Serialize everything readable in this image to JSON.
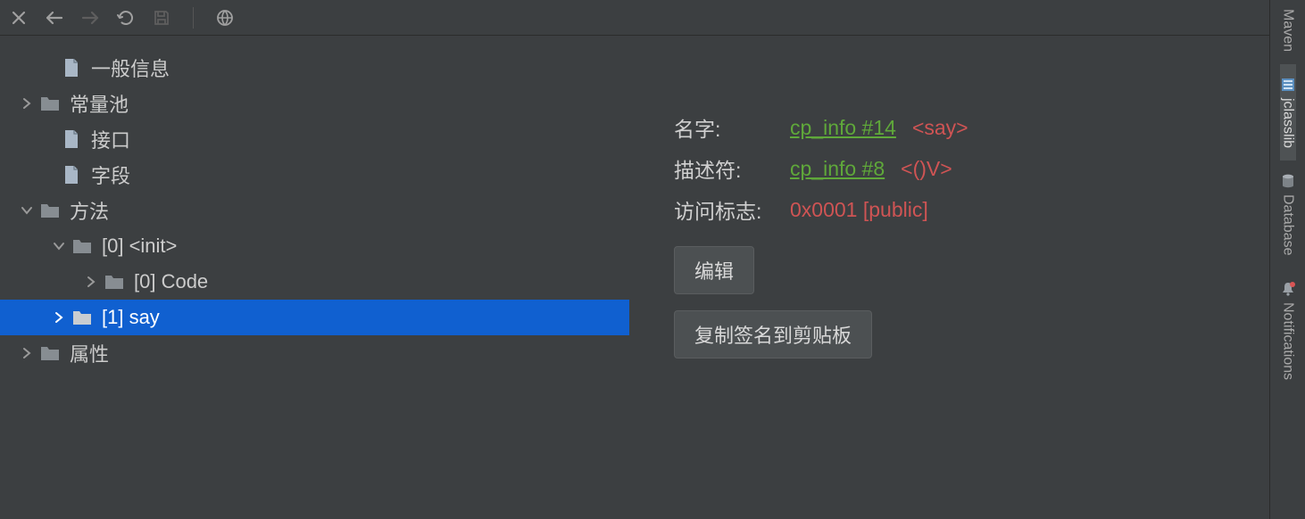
{
  "toolbar_icons": {
    "close": "close-icon",
    "back": "arrow-left-icon",
    "forward": "arrow-right-icon",
    "refresh": "refresh-icon",
    "save": "save-icon",
    "globe": "globe-icon"
  },
  "tree": {
    "items": [
      {
        "label": "一般信息",
        "depth": 0,
        "icon": "file",
        "chevron": "none"
      },
      {
        "label": "常量池",
        "depth": 0,
        "icon": "folder",
        "chevron": "right"
      },
      {
        "label": "接口",
        "depth": 0,
        "icon": "file",
        "chevron": "none"
      },
      {
        "label": "字段",
        "depth": 0,
        "icon": "file",
        "chevron": "none"
      },
      {
        "label": "方法",
        "depth": 0,
        "icon": "folder",
        "chevron": "down"
      },
      {
        "label": "[0] <init>",
        "depth": 1,
        "icon": "folder",
        "chevron": "down"
      },
      {
        "label": "[0] Code",
        "depth": 2,
        "icon": "folder",
        "chevron": "right"
      },
      {
        "label": "[1] say",
        "depth": 1,
        "icon": "folder",
        "chevron": "right",
        "selected": true
      },
      {
        "label": "属性",
        "depth": 0,
        "icon": "folder",
        "chevron": "right"
      }
    ]
  },
  "detail": {
    "name_label": "名字:",
    "name_link": "cp_info #14",
    "name_value": "<say>",
    "desc_label": "描述符:",
    "desc_link": "cp_info #8",
    "desc_value": "<()V>",
    "access_label": "访问标志:",
    "access_value": "0x0001 [public]",
    "edit_button": "编辑",
    "copy_button": "复制签名到剪贴板"
  },
  "rightbar": {
    "items": [
      {
        "label": "Maven",
        "icon": "maven-icon"
      },
      {
        "label": "jclasslib",
        "icon": "jclasslib-icon",
        "active": true
      },
      {
        "label": "Database",
        "icon": "database-icon"
      },
      {
        "label": "Notifications",
        "icon": "bell-icon"
      }
    ]
  }
}
